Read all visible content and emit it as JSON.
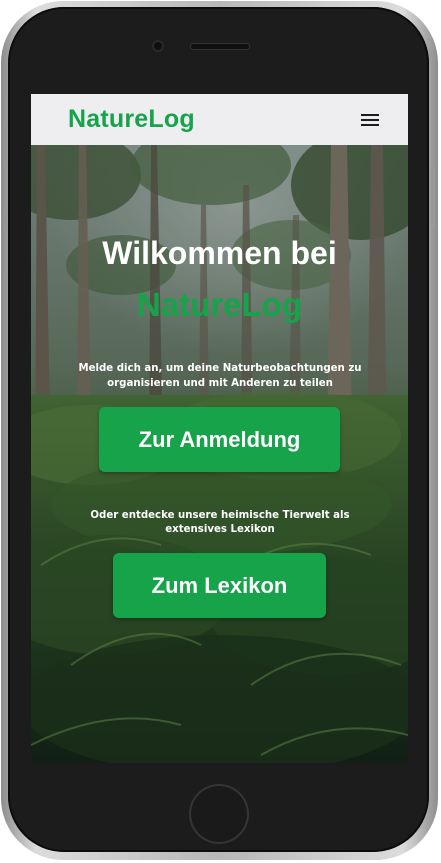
{
  "navbar": {
    "brand": "NatureLog",
    "menu_icon": "hamburger-menu-icon"
  },
  "hero": {
    "title_line1": "Wilkommen bei",
    "title_line2": "NatureLog",
    "login_text": "Melde dich an, um deine Naturbeobachtungen zu organisieren und mit Anderen zu teilen",
    "login_button": "Zur Anmeldung",
    "lexikon_text": "Oder entdecke unsere heimische Tierwelt als extensives Lexikon",
    "lexikon_button": "Zum Lexikon"
  },
  "colors": {
    "accent": "#16a34a",
    "navbar_bg": "#eeeef1",
    "button_text": "#ffffff"
  }
}
